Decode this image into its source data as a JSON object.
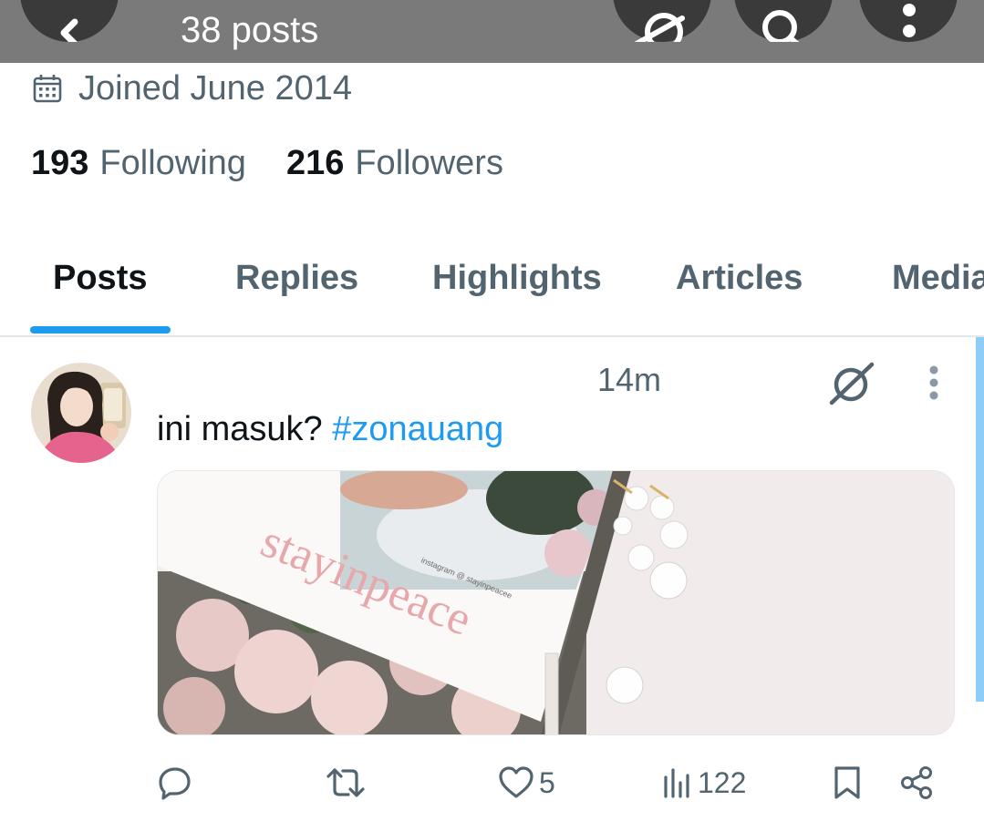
{
  "header": {
    "post_count": "38 posts",
    "back_icon": "arrow-left-icon",
    "grok_icon": "grok-icon",
    "search_icon": "search-icon",
    "more_icon": "more-vertical-icon"
  },
  "profile": {
    "calendar_icon": "calendar-icon",
    "joined": "Joined June 2014",
    "following_count": "193",
    "following_label": "Following",
    "followers_count": "216",
    "followers_label": "Followers"
  },
  "tabs": [
    {
      "label": "Posts",
      "active": true
    },
    {
      "label": "Replies"
    },
    {
      "label": "Highlights"
    },
    {
      "label": "Articles"
    },
    {
      "label": "Media"
    }
  ],
  "post": {
    "time": "14m",
    "text": "ini masuk? ",
    "hashtag": "#zonauang",
    "image_text": {
      "title": "stayinpeace",
      "caption": "instagram @ stayinpeacee"
    },
    "actions": {
      "reply_count": "",
      "repost_count": "",
      "like_count": "5",
      "view_count": "122"
    }
  },
  "colors": {
    "accent": "#1d9bf0",
    "header_bg": "#7a7a7a",
    "muted_text": "#536471",
    "primary_text": "#0f1419"
  }
}
